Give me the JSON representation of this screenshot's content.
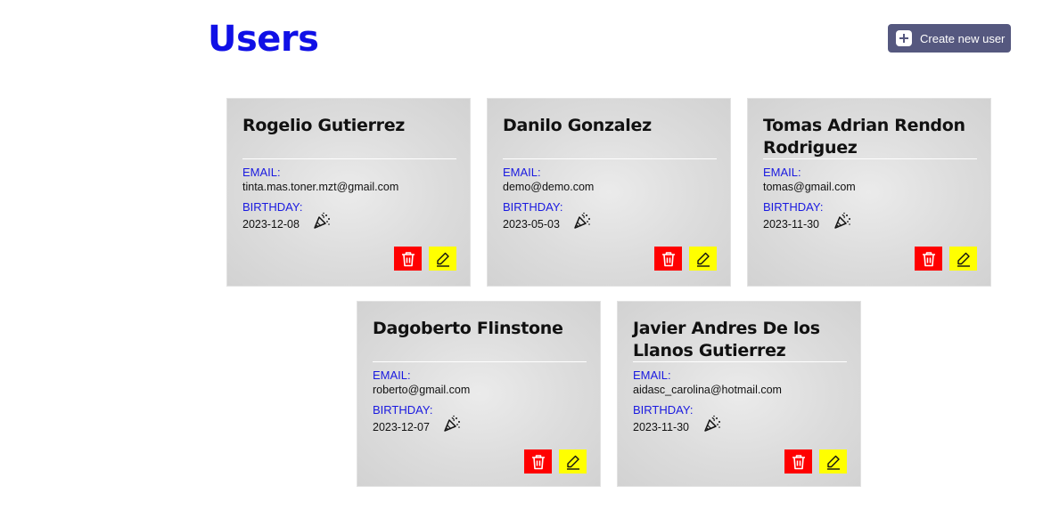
{
  "header": {
    "title": "Users",
    "create_button_label": "Create new user"
  },
  "labels": {
    "email": "EMAIL:",
    "birthday": "BIRTHDAY:"
  },
  "users": [
    {
      "name": "Rogelio Gutierrez",
      "email": "tinta.mas.toner.mzt@gmail.com",
      "birthday": "2023-12-08"
    },
    {
      "name": "Danilo Gonzalez",
      "email": "demo@demo.com",
      "birthday": "2023-05-03"
    },
    {
      "name": "Tomas Adrian Rendon Rodriguez",
      "email": "tomas@gmail.com",
      "birthday": "2023-11-30"
    },
    {
      "name": "Dagoberto Flinstone",
      "email": "roberto@gmail.com",
      "birthday": "2023-12-07"
    },
    {
      "name": "Javier Andres De los Llanos Gutierrez",
      "email": "aidasc_carolina@hotmail.com",
      "birthday": "2023-11-30"
    }
  ],
  "icons": {
    "create": "plus-square-icon",
    "birthday": "party-popper-icon",
    "delete": "trash-icon",
    "edit": "pencil-icon"
  },
  "colors": {
    "title": "#1010e6",
    "create_button_bg": "#55587f",
    "label": "#1a1ae0",
    "delete_bg": "#ff0000",
    "edit_bg": "#ffff00",
    "card_bg": "#dcdcdc"
  }
}
